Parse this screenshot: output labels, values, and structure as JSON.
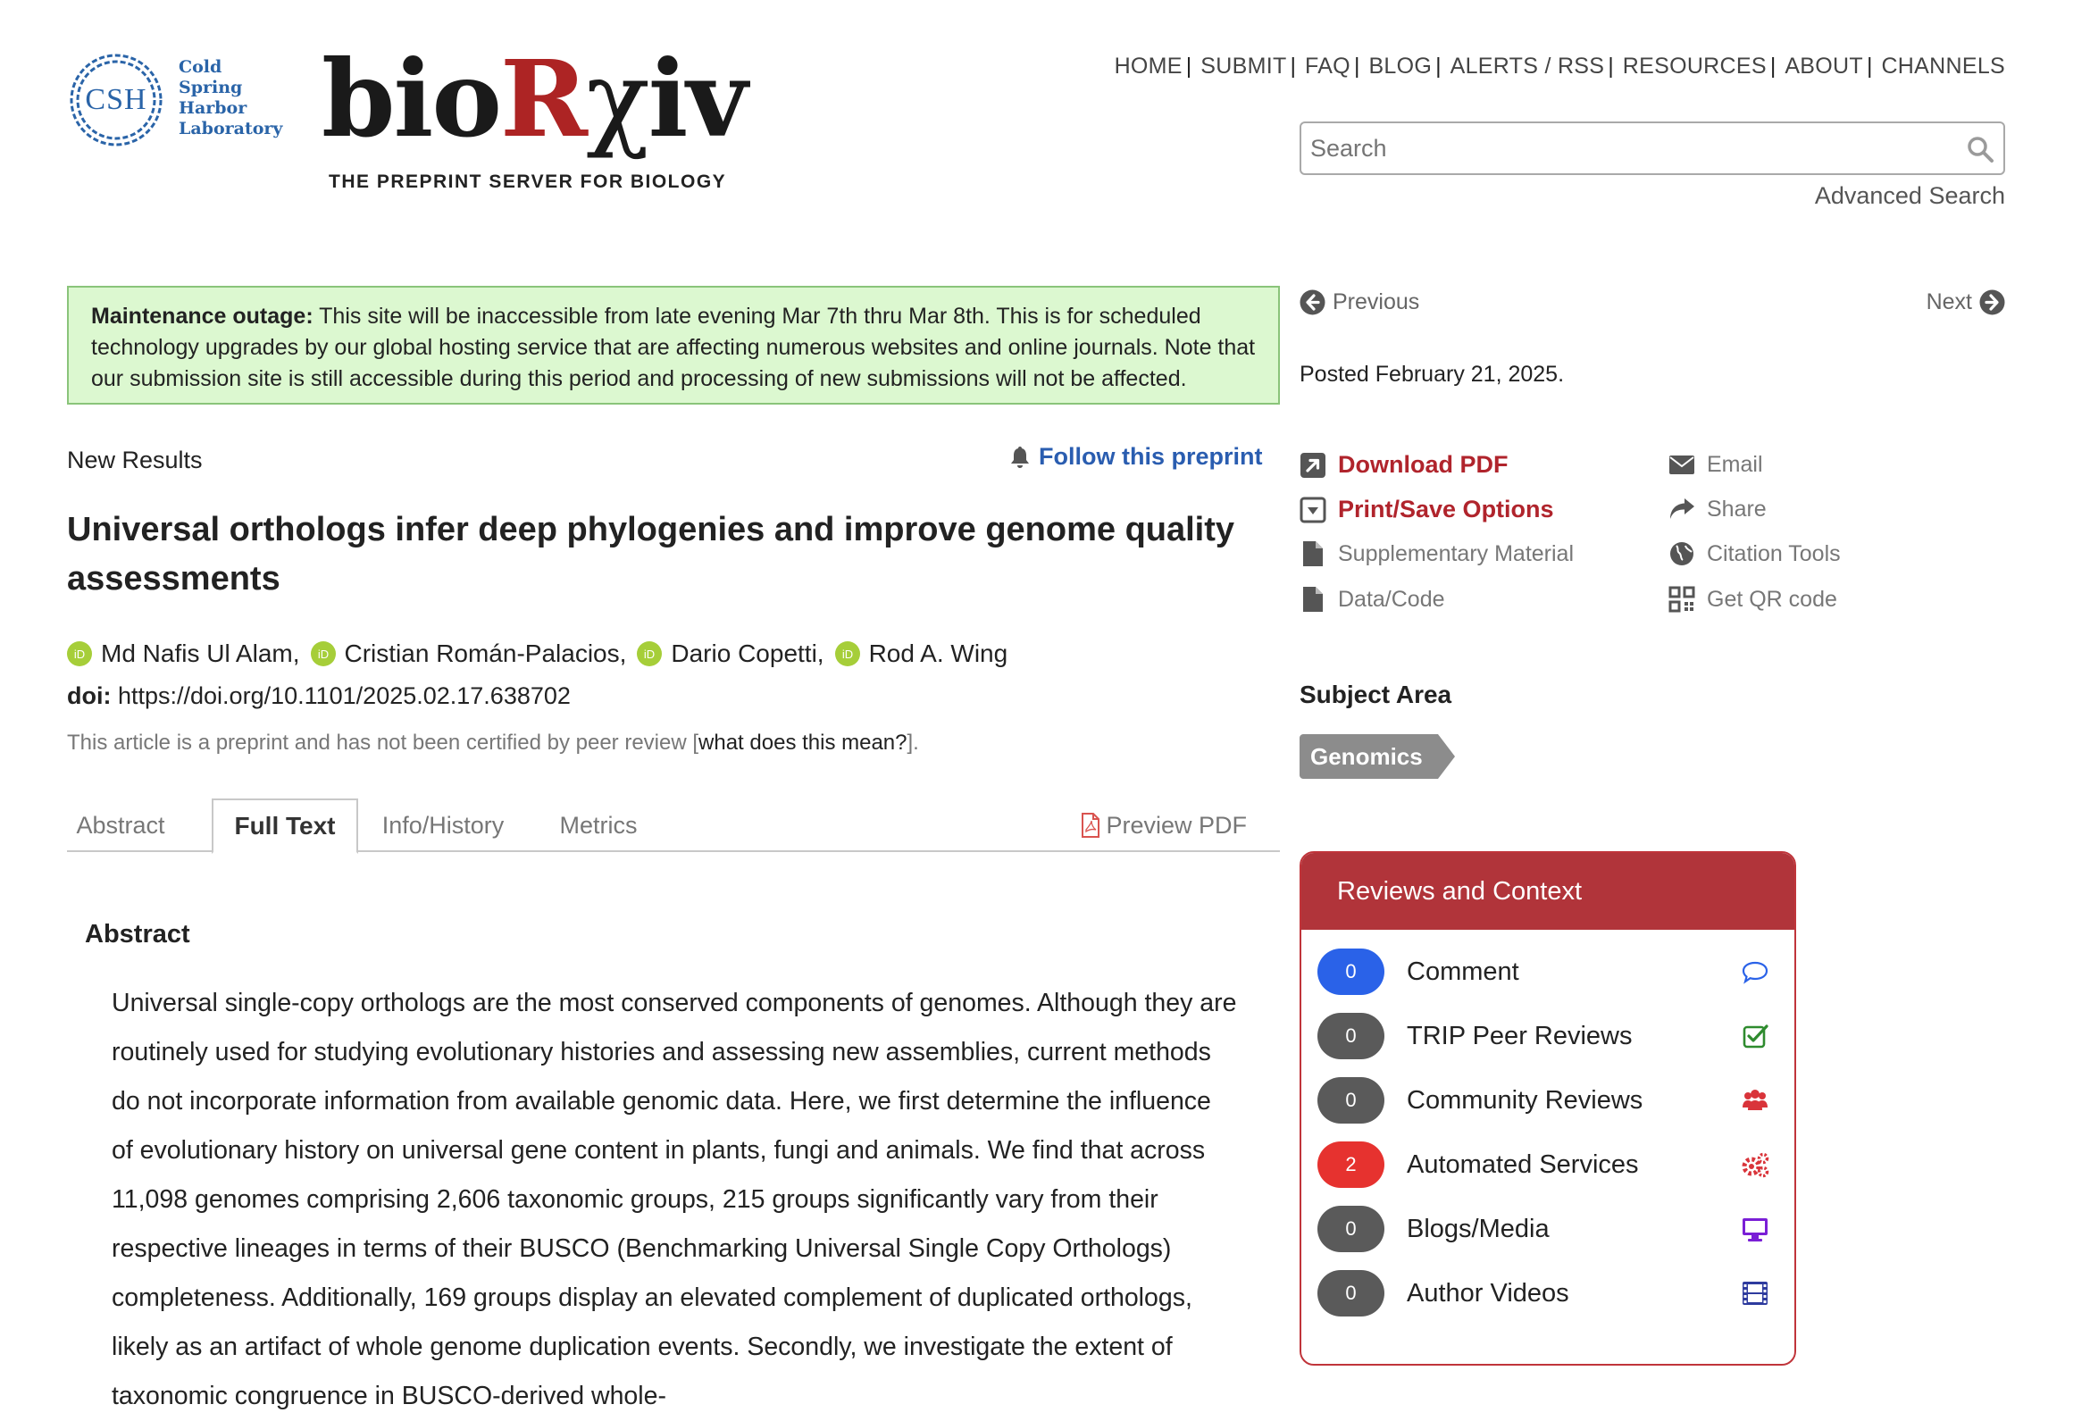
{
  "header": {
    "csh_abbr": "CSH",
    "csh_lines": [
      "Cold",
      "Spring",
      "Harbor",
      "Laboratory"
    ],
    "logo_bio": "bio",
    "logo_r": "R",
    "logo_chi": "χ",
    "logo_iv": "iv",
    "tagline": "THE PREPRINT SERVER FOR BIOLOGY",
    "nav": [
      "HOME",
      "SUBMIT",
      "FAQ",
      "BLOG",
      "ALERTS / RSS",
      "RESOURCES",
      "ABOUT",
      "CHANNELS"
    ],
    "nav_sep": "|",
    "search_placeholder": "Search",
    "advanced_search": "Advanced Search"
  },
  "maintenance": {
    "label": "Maintenance outage:",
    "text": " This site will be inaccessible from late evening Mar 7th thru Mar 8th. This is for scheduled technology upgrades by our global hosting service that are affecting numerous websites and online journals. Note that our submission site is still accessible during this period and processing of new submissions will not be affected."
  },
  "article": {
    "type": "New Results",
    "follow": "Follow this preprint",
    "title": "Universal orthologs infer deep phylogenies and improve genome quality assessments",
    "authors": [
      "Md Nafis Ul Alam,",
      "Cristian Román-Palacios,",
      "Dario Copetti,",
      "Rod A. Wing"
    ],
    "doi_label": "doi:",
    "doi_value": " https://doi.org/10.1101/2025.02.17.638702",
    "peer_note_prefix": "This article is a preprint and has not been certified by peer review [",
    "peer_note_link": "what does this mean?",
    "peer_note_suffix": "]."
  },
  "tabs": {
    "items": [
      "Abstract",
      "Full Text",
      "Info/History",
      "Metrics"
    ],
    "active": "Full Text",
    "preview_pdf": "Preview PDF"
  },
  "abstract": {
    "heading": "Abstract",
    "body": "Universal single-copy orthologs are the most conserved components of genomes. Although they are routinely used for studying evolutionary histories and assessing new assemblies, current methods do not incorporate information from available genomic data. Here, we first determine the influence of evolutionary history on universal gene content in plants, fungi and animals. We find that across 11,098 genomes comprising 2,606 taxonomic groups, 215 groups significantly vary from their respective lineages in terms of their BUSCO (Benchmarking Universal Single Copy Orthologs) completeness. Additionally, 169 groups display an elevated complement of duplicated orthologs, likely as an artifact of whole genome duplication events. Secondly, we investigate the extent of taxonomic congruence in BUSCO-derived whole-"
  },
  "sidebar": {
    "previous": "Previous",
    "next": "Next",
    "posted": "Posted February 21, 2025.",
    "tools": {
      "download_pdf": "Download PDF",
      "print_save": "Print/Save Options",
      "supplementary": "Supplementary Material",
      "data_code": "Data/Code",
      "email": "Email",
      "share": "Share",
      "citation": "Citation Tools",
      "qr": "Get QR code"
    },
    "subject_heading": "Subject Area",
    "subject_tag": "Genomics"
  },
  "reviews": {
    "title": "Reviews and Context",
    "rows": [
      {
        "count": "0",
        "label": "Comment",
        "badge_color": "#2a62e8",
        "icon": "speech-bubble-icon"
      },
      {
        "count": "0",
        "label": "TRIP Peer Reviews",
        "badge_color": "#5a5a5a",
        "icon": "checkbox-icon"
      },
      {
        "count": "0",
        "label": "Community Reviews",
        "badge_color": "#5a5a5a",
        "icon": "users-icon"
      },
      {
        "count": "2",
        "label": "Automated Services",
        "badge_color": "#e6322f",
        "icon": "gears-icon"
      },
      {
        "count": "0",
        "label": "Blogs/Media",
        "badge_color": "#5a5a5a",
        "icon": "monitor-icon"
      },
      {
        "count": "0",
        "label": "Author Videos",
        "badge_color": "#5a5a5a",
        "icon": "film-icon"
      }
    ]
  },
  "colors": {
    "brand_red": "#b0242c",
    "link_blue": "#2a5db0",
    "orcid_green": "#a6ce39",
    "maintenance_bg": "#dcf8d0"
  }
}
